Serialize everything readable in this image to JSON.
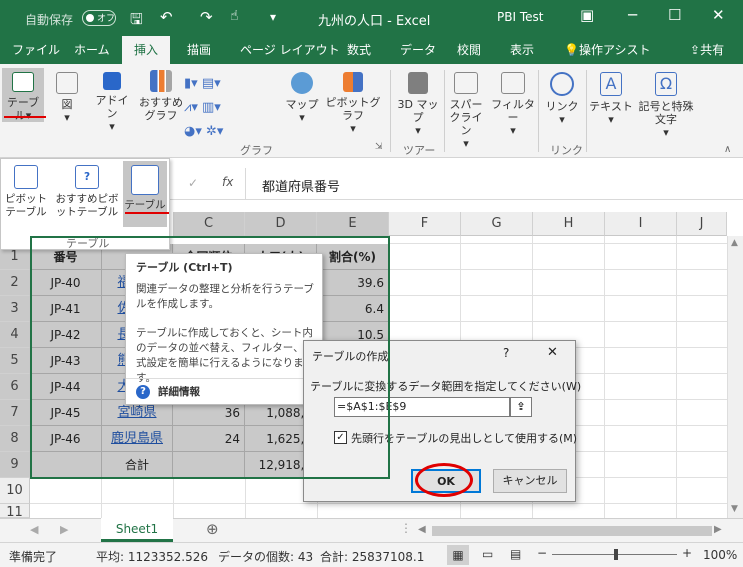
{
  "titlebar": {
    "autosave_label": "自動保存",
    "autosave_state": "オフ",
    "doc_title": "九州の人口 - Excel",
    "user": "PBI Test",
    "accent": "#217346"
  },
  "tabs": [
    "ファイル",
    "ホーム",
    "挿入",
    "描画",
    "ページ レイアウト",
    "数式",
    "データ",
    "校閲",
    "表示",
    "操作アシスト",
    "共有"
  ],
  "active_tab": "挿入",
  "ribbon": {
    "table_btn": "テーブル",
    "illust_btn": "図",
    "addin_btn": "アドイン",
    "rec_chart_btn": "おすすめグラフ",
    "map_btn": "マップ",
    "pivotchart_btn": "ピボットグラフ",
    "map3d_btn": "3D マップ",
    "sparkline_btn": "スパークライン",
    "filter_btn": "フィルター",
    "link_btn": "リンク",
    "text_btn": "テキスト",
    "symbol_btn": "記号と特殊文字",
    "group_chart": "グラフ",
    "group_tour": "ツアー",
    "group_link": "リンク"
  },
  "table_menu": {
    "pivot": "ピボットテーブル",
    "rec_pivot": "おすすめピボットテーブル",
    "table": "テーブル",
    "group": "テーブル"
  },
  "formula_bar": {
    "cancel": "✓",
    "fx": "fx",
    "value": "都道府県番号"
  },
  "columns": [
    "C",
    "D",
    "E",
    "F",
    "G",
    "H",
    "I",
    "J"
  ],
  "rows": [
    "1",
    "2",
    "3",
    "4",
    "5",
    "6",
    "7",
    "8",
    "9",
    "10",
    "11"
  ],
  "table": {
    "headers": [
      "番号",
      "",
      "全国順位",
      "人口(人)",
      "割合(%)"
    ],
    "rows": [
      {
        "a": "JP-40",
        "b": "福岡県",
        "c": "",
        "d": "",
        "e": "39.6"
      },
      {
        "a": "JP-41",
        "b": "佐賀県",
        "c": "",
        "d": "",
        "e": "6.4"
      },
      {
        "a": "JP-42",
        "b": "長崎県",
        "c": "",
        "d": "",
        "e": "10.5"
      },
      {
        "a": "JP-43",
        "b": "熊本県",
        "c": "",
        "d": "",
        "e": ""
      },
      {
        "a": "JP-44",
        "b": "大分県",
        "c": "",
        "d": "",
        "e": ""
      },
      {
        "a": "JP-45",
        "b": "宮崎県",
        "c": "36",
        "d": "1,088,0",
        "e": ""
      },
      {
        "a": "JP-46",
        "b": "鹿児島県",
        "c": "24",
        "d": "1,625,4",
        "e": ""
      }
    ],
    "total_label": "合計",
    "total_value": "12,918,3"
  },
  "tooltip": {
    "title": "テーブル (Ctrl+T)",
    "desc1": "関連データの整理と分析を行うテーブルを作成します。",
    "desc2": "テーブルに作成しておくと、シート内のデータの並べ替え、フィルター、書式設定を簡単に行えるようになります。",
    "more": "詳細情報"
  },
  "dialog": {
    "title": "テーブルの作成",
    "help": "?",
    "close": "✕",
    "prompt": "テーブルに変換するデータ範囲を指定してください(W)",
    "range": "=$A$1:$E$9",
    "checkbox_label": "先頭行をテーブルの見出しとして使用する(M)",
    "checked": true,
    "ok": "OK",
    "cancel": "キャンセル"
  },
  "sheet_tab": "Sheet1",
  "status": {
    "ready": "準備完了",
    "average": "平均: 1123352.526",
    "count": "データの個数: 43",
    "sum": "合計: 25837108.1",
    "zoom": "100%"
  }
}
